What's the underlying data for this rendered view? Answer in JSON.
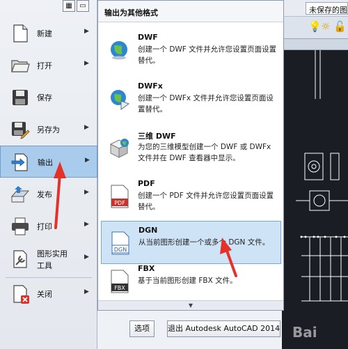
{
  "left_menu": {
    "items": [
      {
        "label": "新建",
        "icon": "new-document-icon"
      },
      {
        "label": "打开",
        "icon": "open-folder-icon"
      },
      {
        "label": "保存",
        "icon": "save-disk-icon"
      },
      {
        "label": "另存为",
        "icon": "save-as-icon"
      },
      {
        "label": "输出",
        "icon": "export-icon"
      },
      {
        "label": "发布",
        "icon": "publish-icon"
      },
      {
        "label": "打印",
        "icon": "printer-icon"
      },
      {
        "label": "图形实用工具",
        "line1": "图形实用",
        "line2": "工具",
        "icon": "drawing-utilities-icon"
      },
      {
        "label": "关闭",
        "icon": "close-drawing-icon"
      }
    ],
    "active_item": "输出"
  },
  "panel": {
    "title": "输出为其他格式",
    "options": [
      {
        "name": "DWF",
        "desc": "创建一个 DWF 文件并允许您设置页面设置替代。",
        "icon": "globe-icon"
      },
      {
        "name": "DWFx",
        "desc": "创建一个 DWFx 文件并允许您设置页面设置替代。",
        "icon": "globe-export-icon"
      },
      {
        "name": "三维 DWF",
        "desc": "为您的三维模型创建一个 DWF 或 DWFx 文件并在 DWF 查看器中显示。",
        "icon": "3d-cube-globe-icon"
      },
      {
        "name": "PDF",
        "desc": "创建一个 PDF 文件并允许您设置页面设置替代。",
        "icon": "pdf-file-icon",
        "badge": "PDF"
      },
      {
        "name": "DGN",
        "desc": "从当前图形创建一个或多个 DGN 文件。",
        "icon": "dgn-file-icon",
        "badge": "DGN"
      },
      {
        "name": "FBX",
        "desc": "基于当前图形创建 FBX 文件。",
        "icon": "fbx-file-icon",
        "badge": "FBX"
      }
    ],
    "highlighted_option": "DGN"
  },
  "bottom_bar": {
    "options_button": "选项",
    "exit_button": "退出 Autodesk AutoCAD 2014"
  },
  "cad_window": {
    "title_field": "未保存的图"
  },
  "colors": {
    "active_menu": "#a9cbec",
    "highlight_option": "#cfe3f7",
    "annotation_arrow": "#e4312a",
    "cad_canvas": "#1a1d24"
  }
}
